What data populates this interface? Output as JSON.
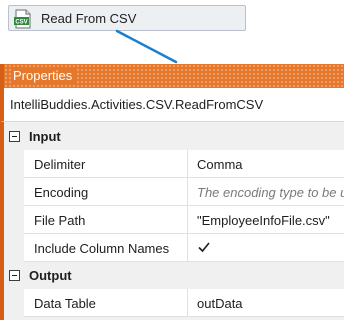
{
  "activity": {
    "label": "Read From CSV",
    "icon": "csv-file-icon",
    "icon_text": "CSV",
    "accent": "#2e8b3d"
  },
  "connector_color": "#1a7fcf",
  "properties": {
    "title": "Properties",
    "title_color": "#e6782c",
    "class_name": "IntelliBuddies.Activities.CSV.ReadFromCSV",
    "categories": [
      {
        "label": "Input",
        "rows": [
          {
            "name": "Delimiter",
            "value": "Comma",
            "placeholder": ""
          },
          {
            "name": "Encoding",
            "value": "",
            "placeholder": "The encoding type to be used"
          },
          {
            "name": "File Path",
            "value": "\"EmployeeInfoFile.csv\"",
            "placeholder": ""
          },
          {
            "name": "Include Column Names",
            "checked": true
          }
        ]
      },
      {
        "label": "Output",
        "rows": [
          {
            "name": "Data Table",
            "value": "outData",
            "placeholder": ""
          }
        ]
      }
    ]
  }
}
